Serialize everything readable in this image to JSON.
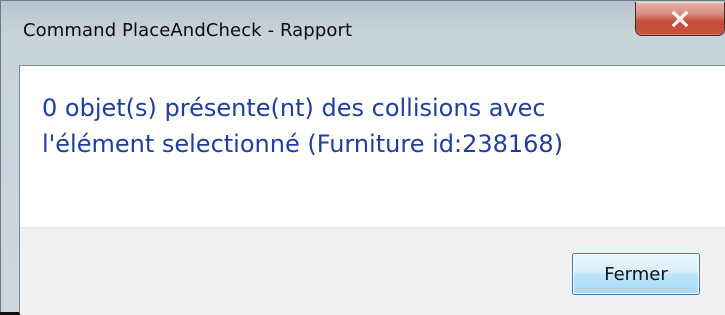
{
  "window": {
    "title": "Command PlaceAndCheck - Rapport"
  },
  "titlebar": {
    "close_icon": "close-icon",
    "close_color": "#c7503f"
  },
  "message": {
    "line1": "0 objet(s) présente(nt) des collisions avec",
    "line2": "l'élément selectionné (Furniture id:238168)",
    "color": "#1e3f9e"
  },
  "footer": {
    "close_button_label": "Fermer"
  }
}
